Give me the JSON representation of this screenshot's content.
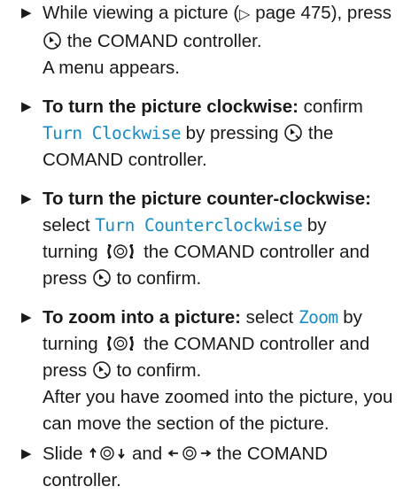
{
  "steps": [
    {
      "lead": "While viewing a picture (",
      "page_ref_icon": "triangle-right-outline-icon",
      "page_ref": "page 475",
      "after_ref": "), press",
      "controller_icon": "press-controller-icon",
      "line2": "the COMAND controller.",
      "result": "A menu appears."
    },
    {
      "bold": "To turn the picture clockwise:",
      "verb": "confirm",
      "menu_item": "Turn Clockwise",
      "middle": "by pressing",
      "controller_icon": "press-controller-icon",
      "tail": "the",
      "line2": "COMAND controller."
    },
    {
      "bold": "To turn the picture counter-clockwise:",
      "verb": "select",
      "menu_item": "Turn Counterclockwise",
      "middle": "by",
      "turning": "turning",
      "turn_icon": "turn-controller-icon",
      "after_turn": "the COMAND controller and",
      "press": "press",
      "controller_icon": "press-controller-icon",
      "confirm": "to confirm."
    },
    {
      "bold": "To zoom into a picture:",
      "verb": "select",
      "menu_item": "Zoom",
      "middle": "by",
      "turning": "turning",
      "turn_icon": "turn-controller-icon",
      "after_turn": "the COMAND controller and",
      "press": "press",
      "controller_icon": "press-controller-icon",
      "confirm": "to confirm.",
      "result_line1": "After you have zoomed into the picture, you",
      "result_line2": "can move the section of the picture."
    },
    {
      "slide": "Slide",
      "slide_vertical_icon": "slide-up-down-controller-icon",
      "and": "and",
      "slide_horizontal_icon": "slide-left-right-controller-icon",
      "the": "the COMAND",
      "line2": "controller."
    }
  ],
  "bullet_icon": "triangle-bullet-icon",
  "colors": {
    "menu_text": "#1a8cc3",
    "body_text": "#1a1a1a"
  }
}
